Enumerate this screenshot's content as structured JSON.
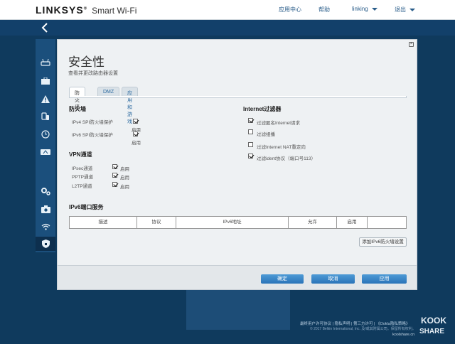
{
  "header": {
    "brand": "LINKSYS",
    "brand_mark": "®",
    "product": "Smart Wi-Fi",
    "nav": [
      "应用中心",
      "帮助",
      "linking",
      "退出"
    ]
  },
  "sidebar": {
    "back_icon": "chevron-left-icon",
    "icons": [
      "router-icon",
      "toolbox-icon",
      "warning-icon",
      "devices-icon",
      "clock-icon",
      "speedometer-icon",
      "settings-gear-icon",
      "camera-icon",
      "wifi-icon",
      "security-shield-icon"
    ]
  },
  "modal": {
    "title": "安全性",
    "subtitle": "查看并更改路由器设置",
    "tabs": [
      "防火墙",
      "DMZ",
      "应用和游戏"
    ],
    "firewall": {
      "heading": "防火墙",
      "ipv4_label": "IPv4 SPI防火墙保护",
      "ipv4_enable": "启用",
      "ipv6_label": "IPv6 SPI防火墙保护",
      "ipv6_enable": "启用"
    },
    "vpn": {
      "heading": "VPN通道",
      "items": [
        {
          "label": "IPsec通道",
          "enable": "启用"
        },
        {
          "label": "PPTP通道",
          "enable": "启用"
        },
        {
          "label": "L2TP通道",
          "enable": "启用"
        }
      ]
    },
    "internet_filter": {
      "heading": "Internet过滤器",
      "items": [
        {
          "label": "过滤匿名Internet请求",
          "checked": true
        },
        {
          "label": "过滤组播",
          "checked": false
        },
        {
          "label": "过滤Internet NAT重定向",
          "checked": false
        },
        {
          "label": "过滤ident协议（端口号113）",
          "checked": true
        }
      ]
    },
    "ipv6_ports": {
      "heading": "IPv6端口服务",
      "columns": [
        "描述",
        "协议",
        "IPv6地址",
        "允许",
        "启用",
        ""
      ],
      "add_button": "添加IPv6防火墙设置"
    },
    "buttons": {
      "ok": "确定",
      "cancel": "取消",
      "apply": "应用"
    }
  },
  "footer": {
    "links": "最终用户许可协议 | 隐私声明 | 第三方许可 | 《Ookla隐私策略》",
    "copyright": "© 2017 Belkin International, Inc. 及/或其附属公司。保留所有权利。"
  },
  "watermark": {
    "line1": "KOOK",
    "line2": "SHARE",
    "site": "koolshare.cn"
  }
}
